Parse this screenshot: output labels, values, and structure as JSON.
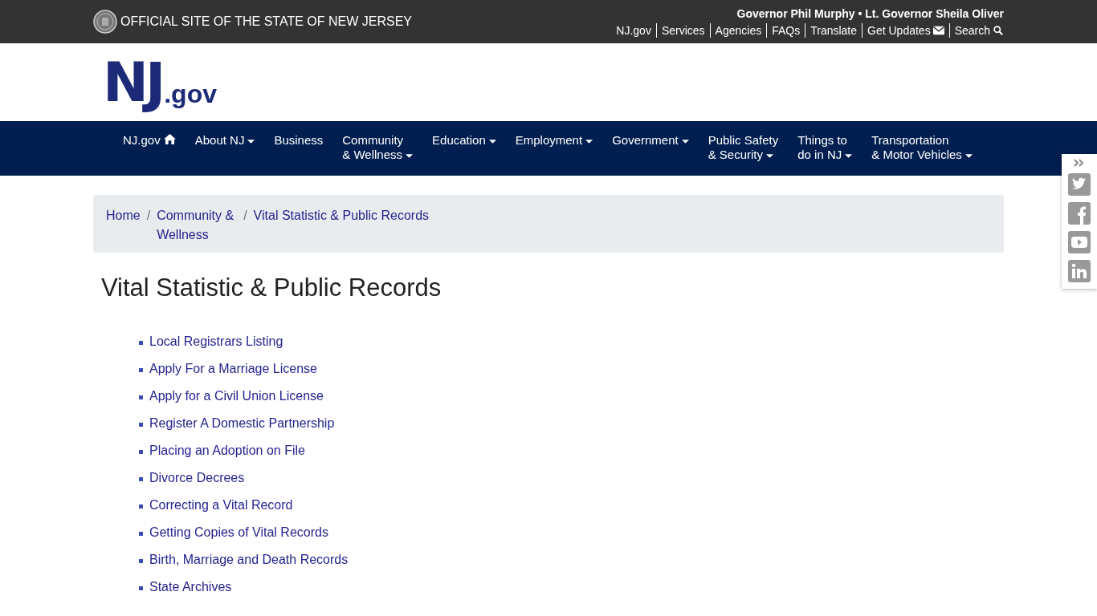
{
  "top_bar": {
    "site_label": "OFFICIAL SITE OF THE STATE OF NEW JERSEY",
    "governor_line": "Governor Phil Murphy • Lt. Governor Sheila Oliver",
    "links": [
      {
        "label": "NJ.gov",
        "kind": "link"
      },
      {
        "label": "Services",
        "kind": "link"
      },
      {
        "label": "Agencies",
        "kind": "link"
      },
      {
        "label": "FAQs",
        "kind": "link"
      },
      {
        "label": "Translate",
        "kind": "link"
      },
      {
        "label": "Get Updates",
        "kind": "updates"
      },
      {
        "label": "Search",
        "kind": "search"
      }
    ]
  },
  "logo": {
    "letters": "NJ",
    "suffix": ".gov"
  },
  "nav": [
    {
      "lines": [
        "NJ.gov"
      ],
      "kind": "home"
    },
    {
      "lines": [
        "About NJ"
      ],
      "kind": "dropdown"
    },
    {
      "lines": [
        "Business"
      ],
      "kind": "link"
    },
    {
      "lines": [
        "Community",
        "& Wellness"
      ],
      "kind": "dropdown"
    },
    {
      "lines": [
        "Education"
      ],
      "kind": "dropdown"
    },
    {
      "lines": [
        "Employment"
      ],
      "kind": "dropdown"
    },
    {
      "lines": [
        "Government"
      ],
      "kind": "dropdown"
    },
    {
      "lines": [
        "Public Safety",
        "& Security"
      ],
      "kind": "dropdown"
    },
    {
      "lines": [
        "Things to",
        "do in NJ"
      ],
      "kind": "dropdown"
    },
    {
      "lines": [
        "Transportation",
        "& Motor Vehicles"
      ],
      "kind": "dropdown"
    }
  ],
  "breadcrumb": {
    "separator": "/",
    "items": [
      "Home",
      "Community & Wellness",
      "Vital Statistic & Public Records"
    ]
  },
  "heading": "Vital Statistic & Public Records",
  "links": [
    "Local Registrars Listing",
    "Apply For a Marriage License",
    "Apply for a Civil Union License",
    "Register A Domestic Partnership",
    "Placing an Adoption on File",
    "Divorce Decrees",
    "Correcting a Vital Record",
    "Getting Copies of Vital Records",
    "Birth, Marriage and Death Records",
    "State Archives"
  ],
  "social": [
    {
      "kind": "twitter"
    },
    {
      "kind": "facebook"
    },
    {
      "kind": "youtube"
    },
    {
      "kind": "linkedin"
    }
  ]
}
